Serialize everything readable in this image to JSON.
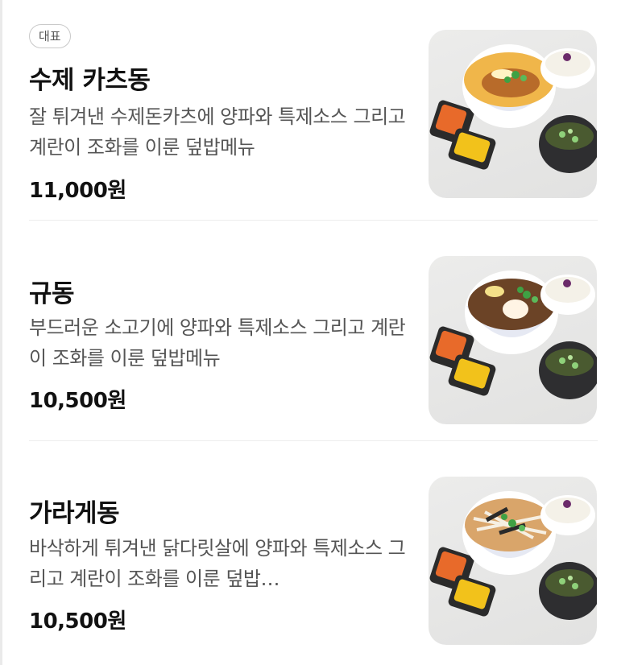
{
  "menu": {
    "items": [
      {
        "badge": "대표",
        "name": "수제 카츠동",
        "description": "잘 튀겨낸 수제돈카츠에 양파와 특제소스 그리고 계란이 조화를 이룬 덮밥메뉴",
        "price": "11,000원",
        "image_icon": "katsudon-photo"
      },
      {
        "name": "규동",
        "description": "부드러운 소고기에 양파와 특제소스 그리고 계란이 조화를 이룬 덮밥메뉴",
        "price": "10,500원",
        "image_icon": "gyudon-photo"
      },
      {
        "name": "가라게동",
        "description": "바삭하게 튀겨낸 닭다릿살에 양파와 특제소스 그리고 계란이 조화를 이룬 덮밥…",
        "price": "10,500원",
        "image_icon": "karaage-don-photo"
      }
    ]
  },
  "colors": {
    "text_primary": "#111111",
    "text_secondary": "#555555",
    "divider": "#ededed",
    "badge_border": "#c9c9c9"
  }
}
